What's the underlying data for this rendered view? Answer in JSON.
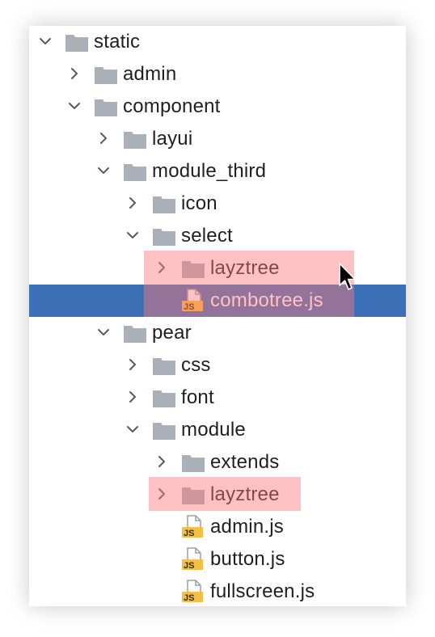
{
  "tree": {
    "items": [
      {
        "label": "static",
        "kind": "folder",
        "chevron": "down"
      },
      {
        "label": "admin",
        "kind": "folder",
        "chevron": "right"
      },
      {
        "label": "component",
        "kind": "folder",
        "chevron": "down"
      },
      {
        "label": "layui",
        "kind": "folder",
        "chevron": "right"
      },
      {
        "label": "module_third",
        "kind": "folder",
        "chevron": "down"
      },
      {
        "label": "icon",
        "kind": "folder",
        "chevron": "right"
      },
      {
        "label": "select",
        "kind": "folder",
        "chevron": "down"
      },
      {
        "label": "layztree",
        "kind": "folder",
        "chevron": "right",
        "highlighted": true
      },
      {
        "label": "combotree.js",
        "kind": "js-file",
        "selected": true,
        "highlighted": true
      },
      {
        "label": "pear",
        "kind": "folder",
        "chevron": "down"
      },
      {
        "label": "css",
        "kind": "folder",
        "chevron": "right"
      },
      {
        "label": "font",
        "kind": "folder",
        "chevron": "right"
      },
      {
        "label": "module",
        "kind": "folder",
        "chevron": "down"
      },
      {
        "label": "extends",
        "kind": "folder",
        "chevron": "right"
      },
      {
        "label": "layztree",
        "kind": "folder",
        "chevron": "right",
        "highlighted": true
      },
      {
        "label": "admin.js",
        "kind": "js-file"
      },
      {
        "label": "button.js",
        "kind": "js-file"
      },
      {
        "label": "fullscreen.js",
        "kind": "js-file"
      }
    ],
    "js_badge_text": "JS"
  },
  "colors": {
    "selection": "#3c6fb6",
    "folder": "#aab0b8",
    "highlight": "#ff7878",
    "js_badge": "#f2c046"
  }
}
